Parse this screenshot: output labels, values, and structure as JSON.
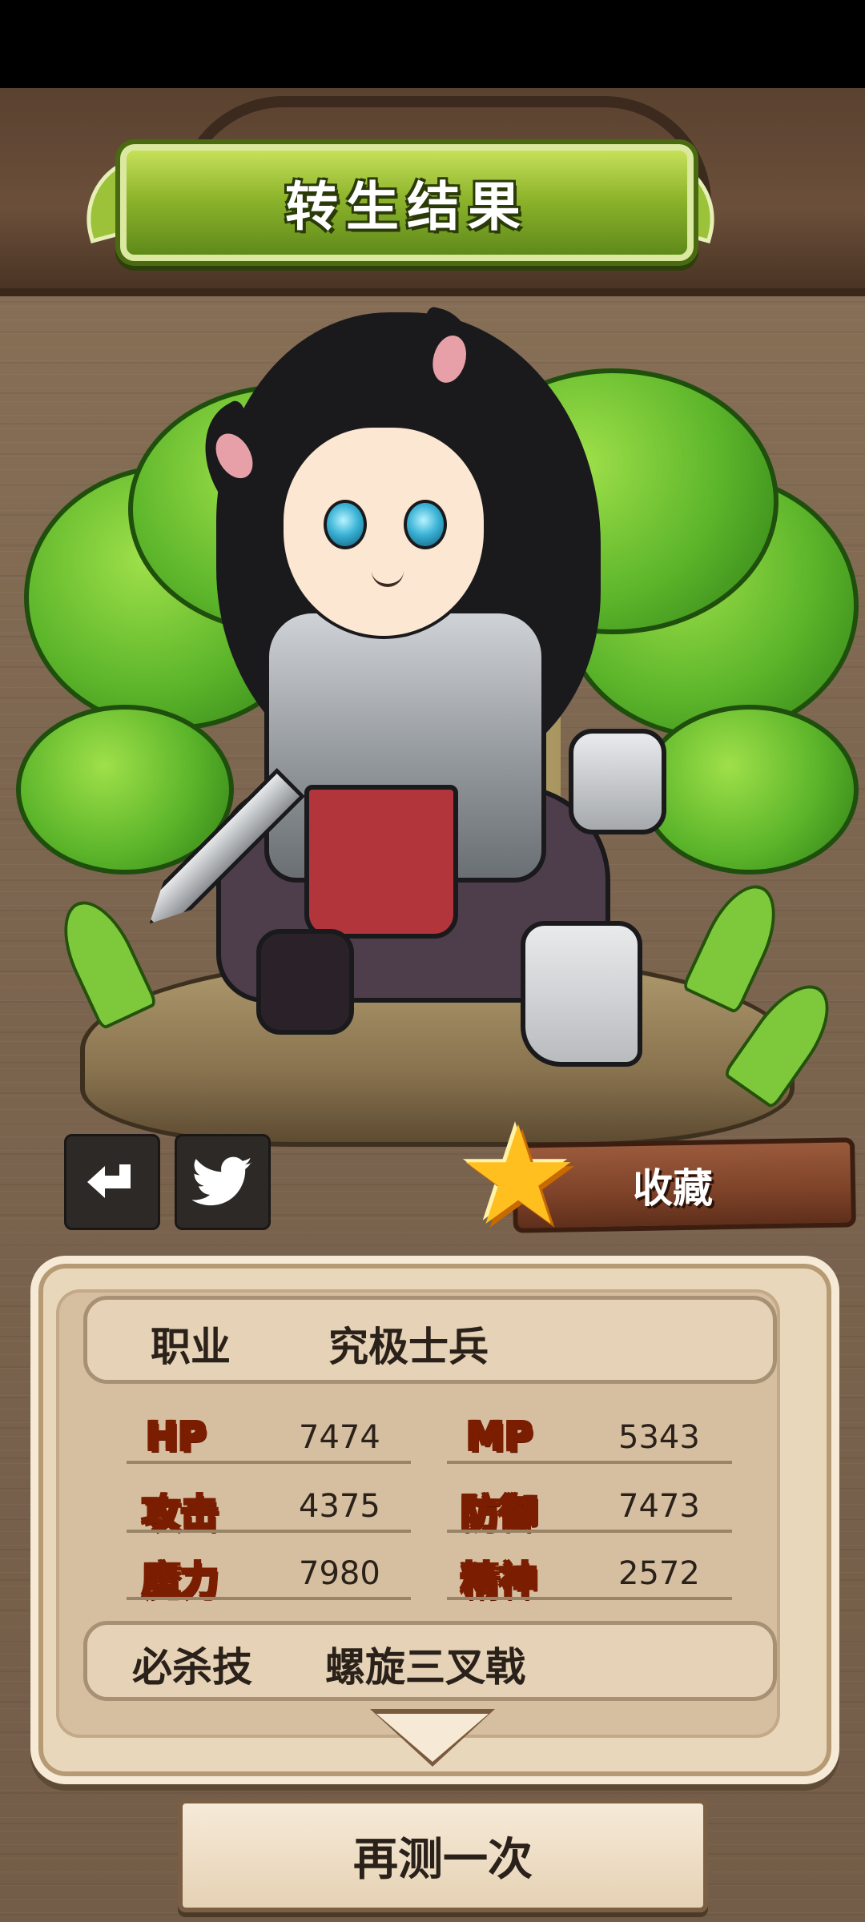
{
  "title": "转生结果",
  "actions": {
    "back_icon": "return-arrow-icon",
    "twitter_icon": "twitter-bird-icon",
    "favorite_label": "收藏",
    "favorite_icon": "star-icon"
  },
  "profile": {
    "job_label": "职业",
    "job_value": "究极士兵",
    "skill_label": "必杀技",
    "skill_value": "螺旋三叉戟"
  },
  "stats": [
    {
      "name": "HP",
      "value": "7474"
    },
    {
      "name": "MP",
      "value": "5343"
    },
    {
      "name": "攻击",
      "value": "4375"
    },
    {
      "name": "防御",
      "value": "7473"
    },
    {
      "name": "魔力",
      "value": "7980"
    },
    {
      "name": "精神",
      "value": "2572"
    }
  ],
  "retry_label": "再测一次",
  "colors": {
    "banner_green": "#8eb52c",
    "favorite_plank": "#7d4228",
    "star": "#ffbf1f",
    "panel": "#e9d7bb"
  }
}
